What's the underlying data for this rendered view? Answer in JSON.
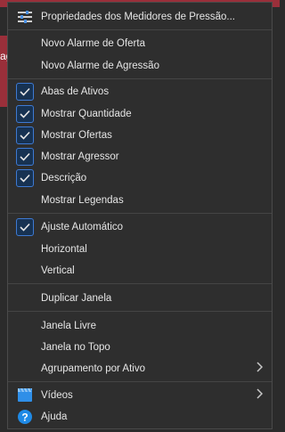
{
  "background": {
    "fragment_text": "ag"
  },
  "menu": {
    "properties": {
      "label": "Propriedades dos Medidores de Pressão...",
      "icon": "sliders-icon"
    },
    "new_offer_alarm": {
      "label": "Novo Alarme de Oferta"
    },
    "new_aggression_alarm": {
      "label": "Novo Alarme de Agressão"
    },
    "asset_tabs": {
      "label": "Abas de Ativos",
      "checked": true
    },
    "show_quantity": {
      "label": "Mostrar Quantidade",
      "checked": true
    },
    "show_offers": {
      "label": "Mostrar Ofertas",
      "checked": true
    },
    "show_aggressor": {
      "label": "Mostrar Agressor",
      "checked": true
    },
    "description": {
      "label": "Descrição",
      "checked": true
    },
    "show_legends": {
      "label": "Mostrar Legendas",
      "checked": false
    },
    "auto_fit": {
      "label": "Ajuste Automático",
      "checked": true
    },
    "horizontal": {
      "label": "Horizontal"
    },
    "vertical": {
      "label": "Vertical"
    },
    "duplicate_window": {
      "label": "Duplicar Janela"
    },
    "free_window": {
      "label": "Janela Livre"
    },
    "window_on_top": {
      "label": "Janela no Topo"
    },
    "group_by_asset": {
      "label": "Agrupamento por Ativo",
      "submenu": true
    },
    "videos": {
      "label": "Vídeos",
      "icon": "video-icon",
      "submenu": true
    },
    "help": {
      "label": "Ajuda",
      "icon": "help-icon"
    }
  },
  "colors": {
    "menu_bg": "#2e2e2e",
    "check_border": "#3e7ad3",
    "check_fill": "#173252",
    "text": "#e6e6e6",
    "separator": "#454545",
    "accent_red": "#9a2f3a"
  }
}
